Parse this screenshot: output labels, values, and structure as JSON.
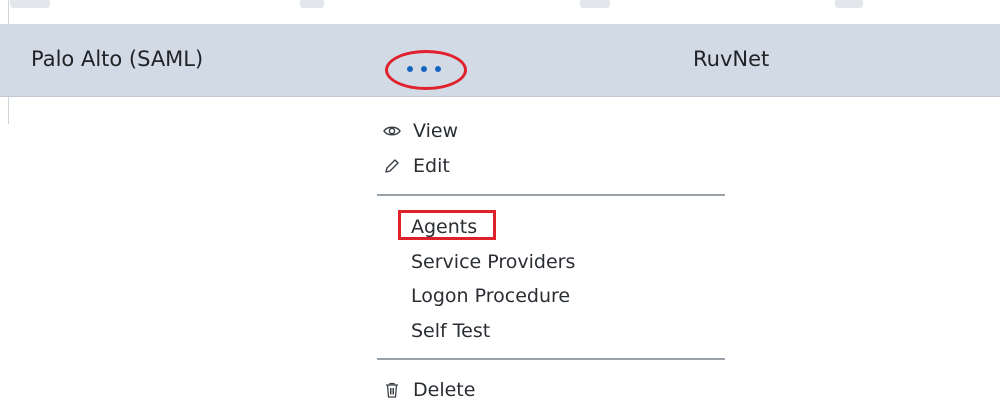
{
  "table": {
    "row": {
      "name": "Palo Alto (SAML)",
      "tenant": "RuvNet",
      "selected_bg": "#d2dae5"
    }
  },
  "actions_menu": {
    "trigger_icon": "more-horizontal-icon",
    "items": [
      {
        "label": "View",
        "icon": "eye-icon"
      },
      {
        "label": "Edit",
        "icon": "pencil-icon"
      },
      {
        "label": "Agents"
      },
      {
        "label": "Service Providers"
      },
      {
        "label": "Logon Procedure"
      },
      {
        "label": "Self Test"
      },
      {
        "label": "Delete",
        "icon": "trash-icon"
      }
    ]
  },
  "colors": {
    "annotation": "#e0202a",
    "dots": "#1565c0"
  }
}
